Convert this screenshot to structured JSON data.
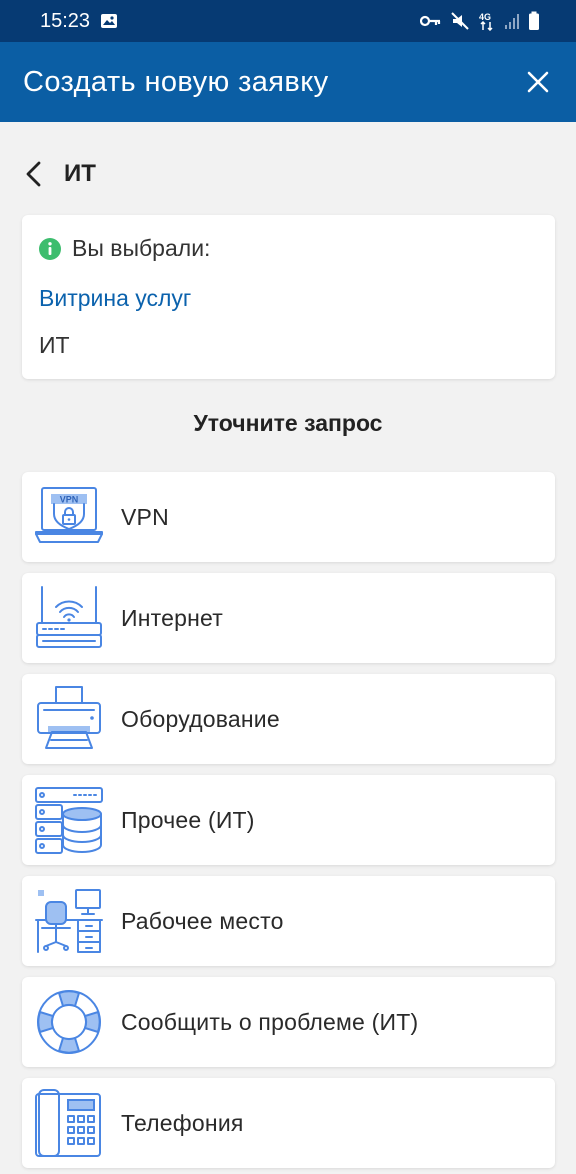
{
  "status_bar": {
    "time": "15:23",
    "network": "4G"
  },
  "app_bar": {
    "title": "Создать новую заявку"
  },
  "breadcrumb": {
    "label": "ИТ"
  },
  "selection": {
    "header": "Вы выбрали:",
    "path_link": "Витрина услуг",
    "current": "ИТ"
  },
  "section_title": "Уточните запрос",
  "items": [
    {
      "label": "VPN",
      "icon": "vpn-laptop-icon"
    },
    {
      "label": "Интернет",
      "icon": "router-icon"
    },
    {
      "label": "Оборудование",
      "icon": "printer-icon"
    },
    {
      "label": "Прочее (ИТ)",
      "icon": "server-database-icon"
    },
    {
      "label": "Рабочее место",
      "icon": "workplace-desk-icon"
    },
    {
      "label": "Сообщить о проблеме (ИТ)",
      "icon": "lifebuoy-icon"
    },
    {
      "label": "Телефония",
      "icon": "desk-phone-icon"
    }
  ],
  "colors": {
    "status_bar": "#063a73",
    "app_bar": "#0b5ea4",
    "link": "#0b62ad",
    "info_icon": "#3dbd6e",
    "icon_stroke": "#4a86e3"
  }
}
